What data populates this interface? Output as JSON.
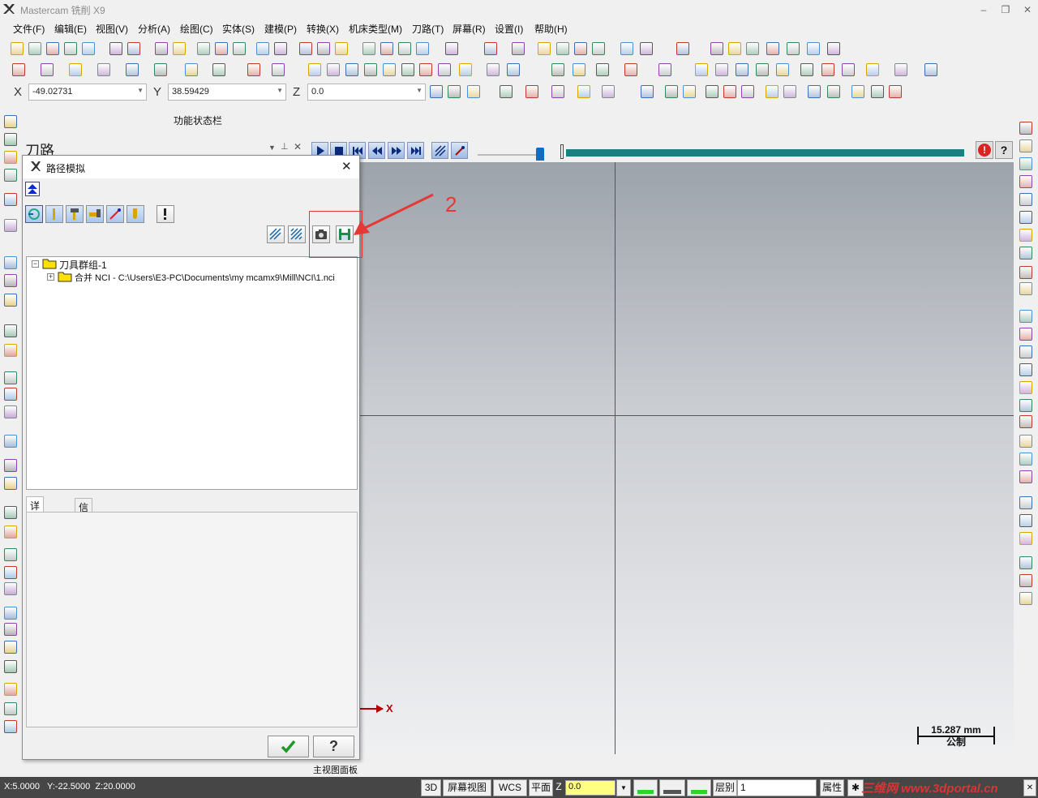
{
  "window": {
    "title": "Mastercam 铣削 X9",
    "minimize": "–",
    "maximize": "❐",
    "close": "✕"
  },
  "menu": [
    "文件(F)",
    "编辑(E)",
    "视图(V)",
    "分析(A)",
    "绘图(C)",
    "实体(S)",
    "建模(P)",
    "转换(X)",
    "机床类型(M)",
    "刀路(T)",
    "屏幕(R)",
    "设置(I)",
    "帮助(H)"
  ],
  "coords": {
    "x_label": "X",
    "x_value": "-49.02731",
    "y_label": "Y",
    "y_value": "38.59429",
    "z_label": "Z",
    "z_value": "0.0"
  },
  "status_hint": "功能状态栏",
  "toolpath_panel": {
    "title": "刀路",
    "pin": "⊥",
    "close": "✕"
  },
  "dialog": {
    "title": "路径模拟",
    "close": "✕",
    "tree": {
      "group": "刀具群组-1",
      "item": "合并 NCI - C:\\Users\\E3-PC\\Documents\\my mcamx9\\Mill\\NCI\\1.nci"
    },
    "tabs": [
      "详细信息",
      "信息"
    ]
  },
  "annotation": {
    "number": "2",
    "color": "#e53935"
  },
  "viewport": {
    "axis_label": "X",
    "scale_value": "15.287 mm",
    "scale_unit": "公制",
    "panel_label": "主视图面板"
  },
  "bottombar": {
    "coords": "X:5.0000   Y:-22.5000  Z:20.0000",
    "mode_3d": "3D",
    "screen_view": "屏幕视图",
    "wcs": "WCS",
    "plane": "平面",
    "z_label": "Z",
    "z_value": "0.0",
    "level_label": "层别",
    "level_value": "1",
    "attr": "属性",
    "star": "✱",
    "watermark": "三维网 www.3dportal.cn"
  }
}
